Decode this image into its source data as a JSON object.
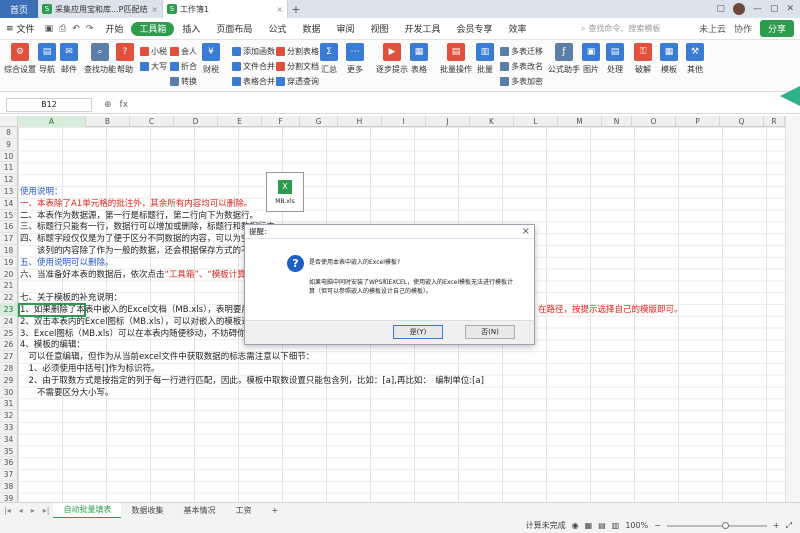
{
  "tabs": {
    "home": "首页",
    "doc1": "采集应用宝和库...P匹配结果mm",
    "doc2": "工作簿1",
    "close": "×",
    "add": "+"
  },
  "menu": {
    "file": "文件",
    "items": [
      "开始",
      "工具箱",
      "插入",
      "页面布局",
      "公式",
      "数据",
      "审阅",
      "视图",
      "开发工具",
      "会员专享",
      "效率"
    ],
    "search": "查找命令、搜索模板",
    "cloud": "未上云",
    "collab": "协作",
    "share": "分享"
  },
  "ribbon": {
    "big": [
      "综合设置",
      "导航",
      "邮件",
      "查找功能",
      "帮助",
      "财税",
      "汇总",
      "更多",
      "逐步提示",
      "表格",
      "批量操作",
      "批量",
      "公式助手",
      "图片",
      "处理",
      "破解",
      "模板",
      "其他"
    ],
    "small": [
      "小税",
      "大写",
      "会人",
      "折合",
      "转换",
      "添加函数",
      "文件合并",
      "表格合并",
      "分割表格",
      "分割文档",
      "穿透查询",
      "多表迁移",
      "多表改名",
      "多表加密"
    ]
  },
  "formula": {
    "cell": "B12",
    "fx": "fx"
  },
  "columns": [
    "A",
    "B",
    "C",
    "D",
    "E",
    "F",
    "G",
    "H",
    "I",
    "J",
    "K",
    "L",
    "M",
    "N",
    "O",
    "P",
    "Q",
    "R"
  ],
  "rows": [
    "8",
    "9",
    "10",
    "11",
    "12",
    "13",
    "14",
    "15",
    "16",
    "17",
    "18",
    "19",
    "20",
    "21",
    "22",
    "23",
    "24",
    "25",
    "26",
    "27",
    "28",
    "29",
    "30",
    "31",
    "32",
    "33",
    "34",
    "35",
    "36",
    "37",
    "38",
    "39",
    "40"
  ],
  "embed": {
    "name": "MB.xls"
  },
  "sheet": {
    "l15": "使用说明：",
    "l16": "一、本表除了A1单元格的批注外，其余所有内容均可以删除。",
    "l17": "二、本表作为数据源，第一行是标题行，第二行向下为数据行。",
    "l18": "三、标题行只能有一行，数据行可以增加或删除，标题行和数据行中",
    "l19": "四、标题字段仅仅是为了便于区分不同数据的内容，可以为空。但如",
    "l20": "　　该列的内容除了作为一般的数据，还会根据保存方式的不同，会",
    "l21": "五、使用说明可以删除。",
    "l22": "六、当准备好本表的数据后，依次点击",
    "l22b": "“工具箱”、“模板计算”",
    "l22c": "就",
    "l24": "七、关于模板的补充说明：",
    "l25a": "1、如果删除了本表中嵌入的Excel文档（MB.xls），表明要用外部模",
    "l25b": "在路径，按提示选择自己的模版即可。",
    "l26": "2、双击本表内的Excel图标（MB.xls），可以对嵌入的模板进行编辑",
    "l27": "3、Excel图标（MB.xls）可以在本表内随便移动，不妨碍你着满数据",
    "l28": "4、模板的编辑：",
    "l29": "　可以任意编辑，但作为从当前excel文件中获取数据的标志需注意以下细节：",
    "l30": "　1、必须使用中括号[]作为标识符。",
    "l31": "　2、由于取数方式是按指定的列于每一行进行匹配，因此，模板中取数设置只能包含列，比如：[a],再比如：　编制单位:[a]",
    "l32": "　　不需要区分大小写。"
  },
  "dialog": {
    "title": "提醒:",
    "q": "?",
    "msg1": "是否使用本表中嵌入的Excel模板?",
    "msg2": "如果电脑中同时安装了WPS和EXCEL，使用嵌入的Excel模板无法进行模板计算（但可以参照嵌入的模板设计自己的模板）。",
    "yes": "是(Y)",
    "no": "否(N)",
    "close": "×"
  },
  "sheettabs": [
    "自动批量填表",
    "数据收集",
    "基本情况",
    "工资"
  ],
  "status": {
    "calc": "计算未完成",
    "zoom": "100%",
    "minus": "−",
    "plus": "+"
  },
  "colors": {
    "accent": "#2d9c4e",
    "blue": "#2256c0",
    "red": "#e0221a"
  }
}
